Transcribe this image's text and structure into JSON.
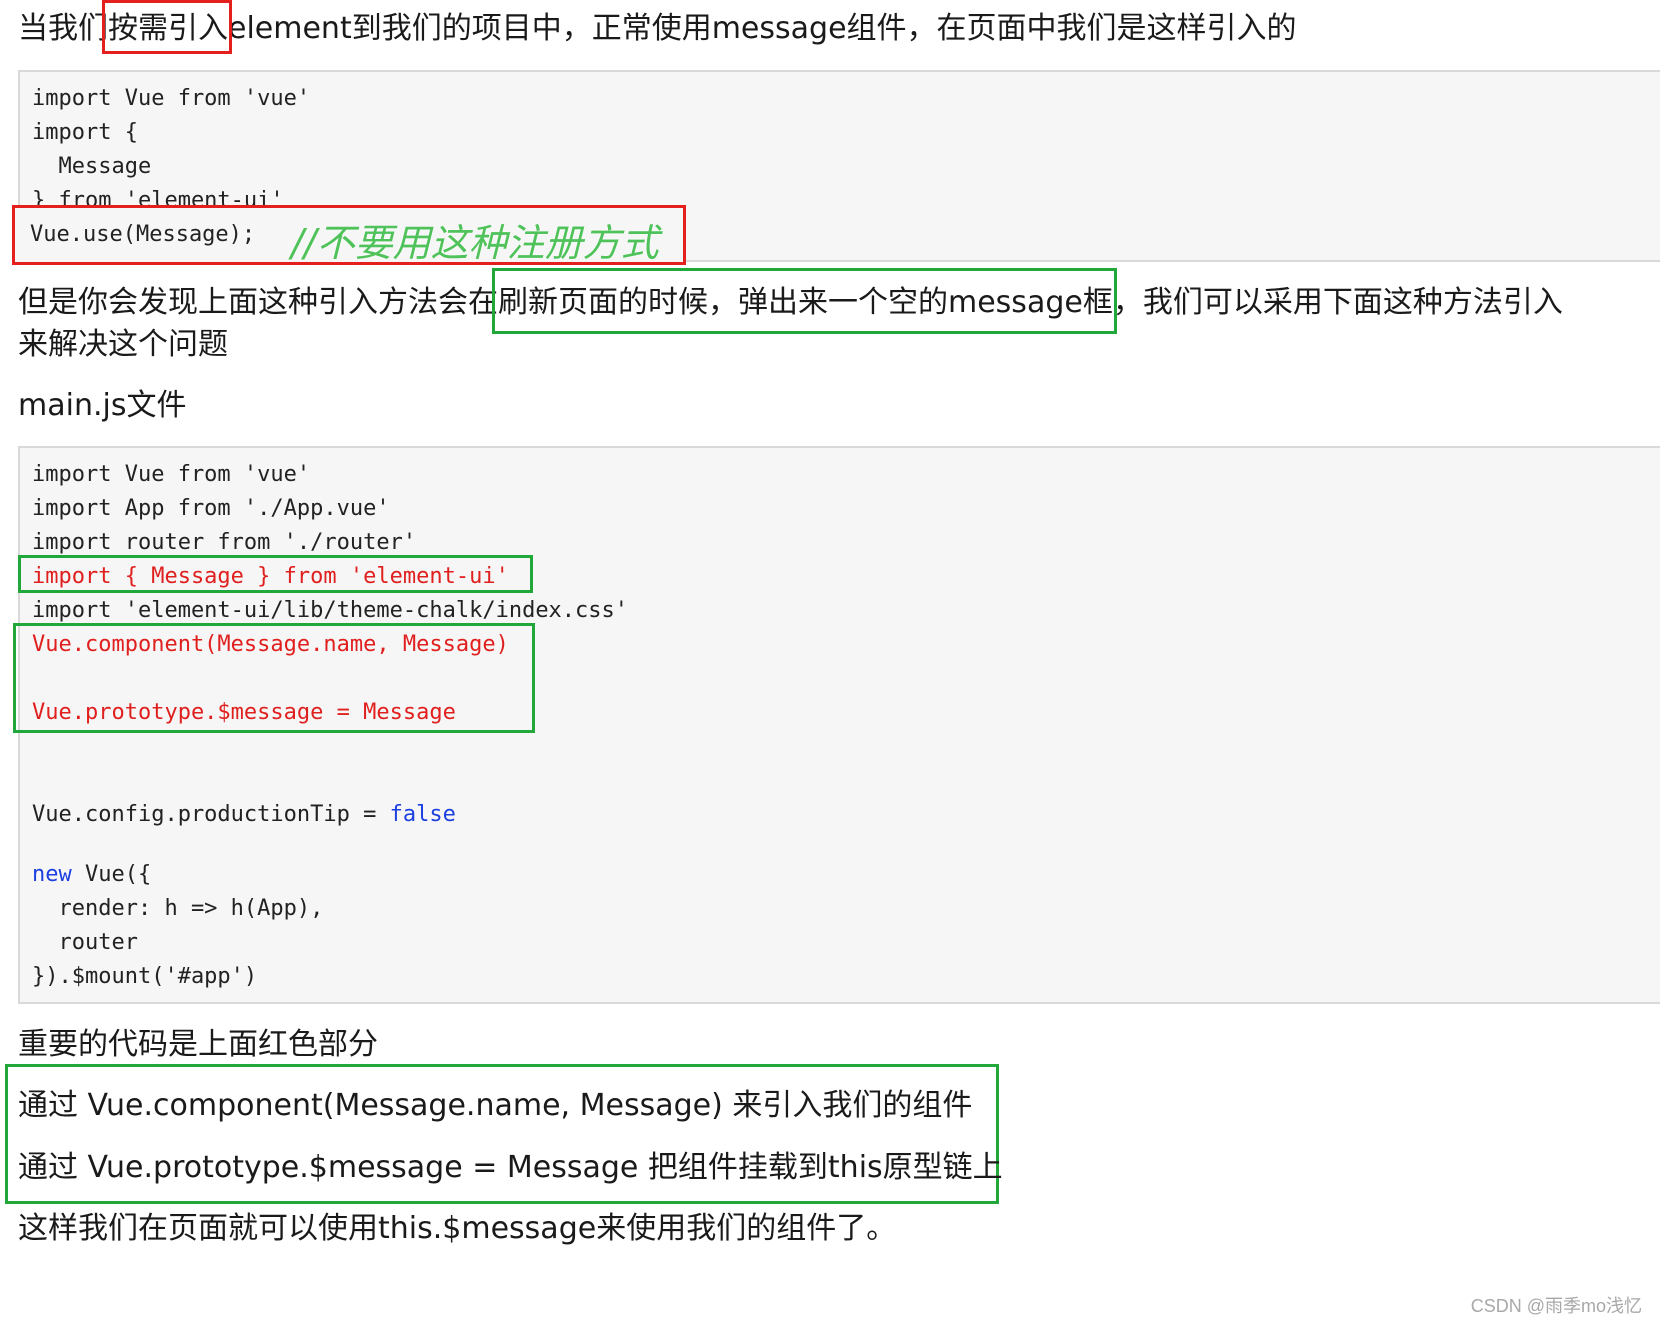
{
  "intro": {
    "text_a": "当我们",
    "text_highlight": "按需引入",
    "text_b": "element到我们的项目中，正常使用message组件，在页面中我们是这样引入的"
  },
  "code1": {
    "lines": [
      "import Vue from 'vue'",
      "import {",
      "  Message",
      "} from 'element-ui'",
      "Vue.use(Message);"
    ],
    "annotation": "//不要用这种注册方式"
  },
  "para2": {
    "line1_a": "但是你会发现上面这种引入方法会在",
    "line1_highlight": "刷新页面的时候，弹出来一个空的message框",
    "line1_b": "，我们可以采用下面这种方法引入",
    "line2": "来解决这个问题"
  },
  "section_title": "main.js文件",
  "code2": {
    "line1": "import Vue from 'vue'",
    "line2": "import App from './App.vue'",
    "line3": "import router from './router'",
    "line4": "import { Message } from 'element-ui'",
    "line5": "import 'element-ui/lib/theme-chalk/index.css'",
    "line6": "Vue.component(Message.name, Message)",
    "line7": "Vue.prototype.$message = Message",
    "line8_a": "Vue.config.productionTip = ",
    "line8_b": "false",
    "line9_a": "new",
    "line9_b": " Vue({",
    "line10": "  render: h => h(App),",
    "line11": "  router",
    "line12": "}).$mount('#app')"
  },
  "summary": {
    "heading": "重要的代码是上面红色部分",
    "item1": "通过 Vue.component(Message.name, Message) 来引入我们的组件",
    "item2": "通过 Vue.prototype.$message = Message 把组件挂载到this原型链上",
    "conclusion": "这样我们在页面就可以使用this.$message来使用我们的组件了。"
  },
  "watermark": "CSDN @雨季mo浅忆",
  "colors": {
    "highlight_red": "#e3201e",
    "highlight_green": "#22a83a",
    "code_red": "#e0201f",
    "keyword_blue": "#1c3fe0",
    "code_bg": "#f6f6f6"
  }
}
